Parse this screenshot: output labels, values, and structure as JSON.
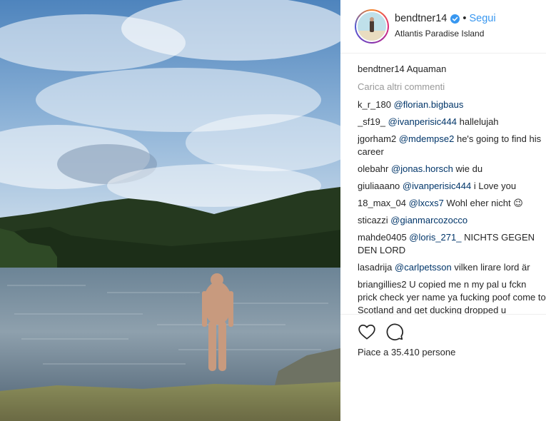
{
  "post": {
    "username": "bendtner14",
    "follow_label": "Segui",
    "separator": "•",
    "location": "Atlantis Paradise Island",
    "caption": {
      "user": "bendtner14",
      "text": "Aquaman"
    },
    "load_more": "Carica altri commenti",
    "likes": "Piace a 35.410 persone",
    "accent_color": "#3897f0"
  },
  "comments": [
    {
      "user": "k_r_180",
      "mention": "@florian.bigbaus",
      "text": ""
    },
    {
      "user": "_sf19_",
      "mention": "@ivanperisic444",
      "text": "hallelujah"
    },
    {
      "user": "jgorham2",
      "mention": "@mdempse2",
      "text": "he's going to find his career"
    },
    {
      "user": "olebahr",
      "mention": "@jonas.horsch",
      "text": "wie du"
    },
    {
      "user": "giuliaaano",
      "mention": "@ivanperisic444",
      "text": "i Love you"
    },
    {
      "user": "18_max_04",
      "mention": "@lxcxs7",
      "text": "Wohl eher nicht 😉"
    },
    {
      "user": "sticazzi",
      "mention": "@gianmarcozocco",
      "text": ""
    },
    {
      "user": "mahde0405",
      "mention": "@loris_271_",
      "text": "NICHTS GEGEN DEN LORD"
    },
    {
      "user": "lasadrija",
      "mention": "@carlpetsson",
      "text": "vilken lirare lord är"
    },
    {
      "user": "briangillies2",
      "mention": "",
      "text": "U copied me n my pal u fckn prick check yer name ya fucking poof come to Scotland and get ducking dropped u"
    }
  ],
  "icons": {
    "like": "heart-icon",
    "comment": "comment-icon",
    "verified": "verified-badge-icon"
  }
}
